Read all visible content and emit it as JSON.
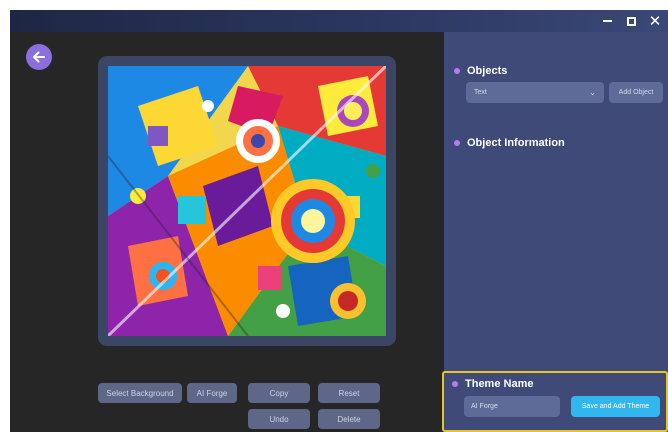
{
  "window": {
    "minimize_icon": "minimize-icon",
    "maximize_icon": "maximize-icon",
    "close_icon": "close-icon",
    "close_glyph": "✕"
  },
  "navigation": {
    "back_icon": "arrow-left-icon"
  },
  "canvas": {
    "image": "abstract colorful geometric artwork with spirals and cubes"
  },
  "toolbar": {
    "select_background": "Select Background",
    "ai_forge": "AI Forge",
    "copy": "Copy",
    "reset": "Reset",
    "undo": "Undo",
    "delete": "Delete"
  },
  "objects_panel": {
    "title": "Objects",
    "select_value": "Text",
    "add_object": "Add Object"
  },
  "object_info": {
    "title": "Object Information"
  },
  "theme_panel": {
    "title": "Theme Name",
    "input_value": "AI Forge",
    "save_button": "Save and Add Theme"
  },
  "colors": {
    "accent_purple": "#8b6fe0",
    "panel_blue": "#3f4a78",
    "save_cyan": "#2fb7ee",
    "highlight_yellow": "#e6c527"
  }
}
